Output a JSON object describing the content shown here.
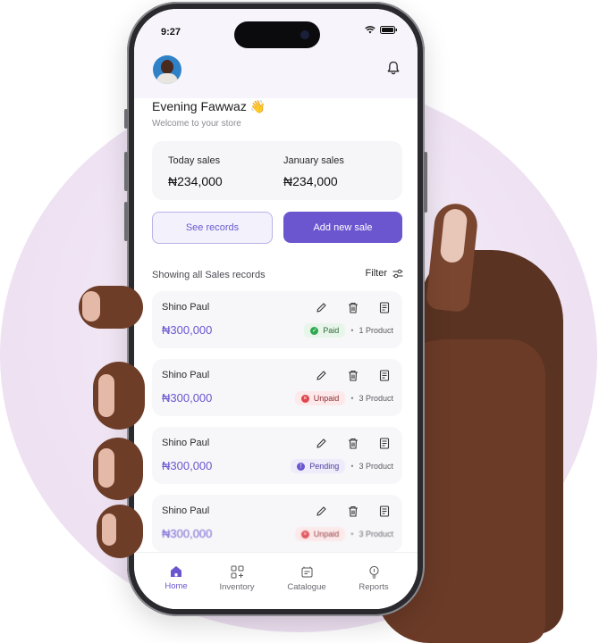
{
  "status_bar": {
    "time": "9:27"
  },
  "header": {
    "greeting": "Evening Fawwaz 👋",
    "subtitle": "Welcome to your store"
  },
  "stats": {
    "today_label": "Today sales",
    "today_value": "₦234,000",
    "month_label": "January sales",
    "month_value": "₦234,000"
  },
  "buttons": {
    "see_records": "See records",
    "add_sale": "Add new sale"
  },
  "list": {
    "heading": "Showing all Sales records",
    "filter_label": "Filter",
    "records": [
      {
        "name": "Shino Paul",
        "amount": "₦300,000",
        "status": "Paid",
        "products": "1 Product"
      },
      {
        "name": "Shino Paul",
        "amount": "₦300,000",
        "status": "Unpaid",
        "products": "3 Product"
      },
      {
        "name": "Shino Paul",
        "amount": "₦300,000",
        "status": "Pending",
        "products": "3 Product"
      },
      {
        "name": "Shino Paul",
        "amount": "₦300,000",
        "status": "Unpaid",
        "products": "3 Product"
      }
    ]
  },
  "nav": {
    "home": "Home",
    "inventory": "Inventory",
    "catalogue": "Catalogue",
    "reports": "Reports"
  },
  "colors": {
    "accent": "#6b56cf",
    "paid": "#2fa84f",
    "unpaid": "#e0454c"
  }
}
